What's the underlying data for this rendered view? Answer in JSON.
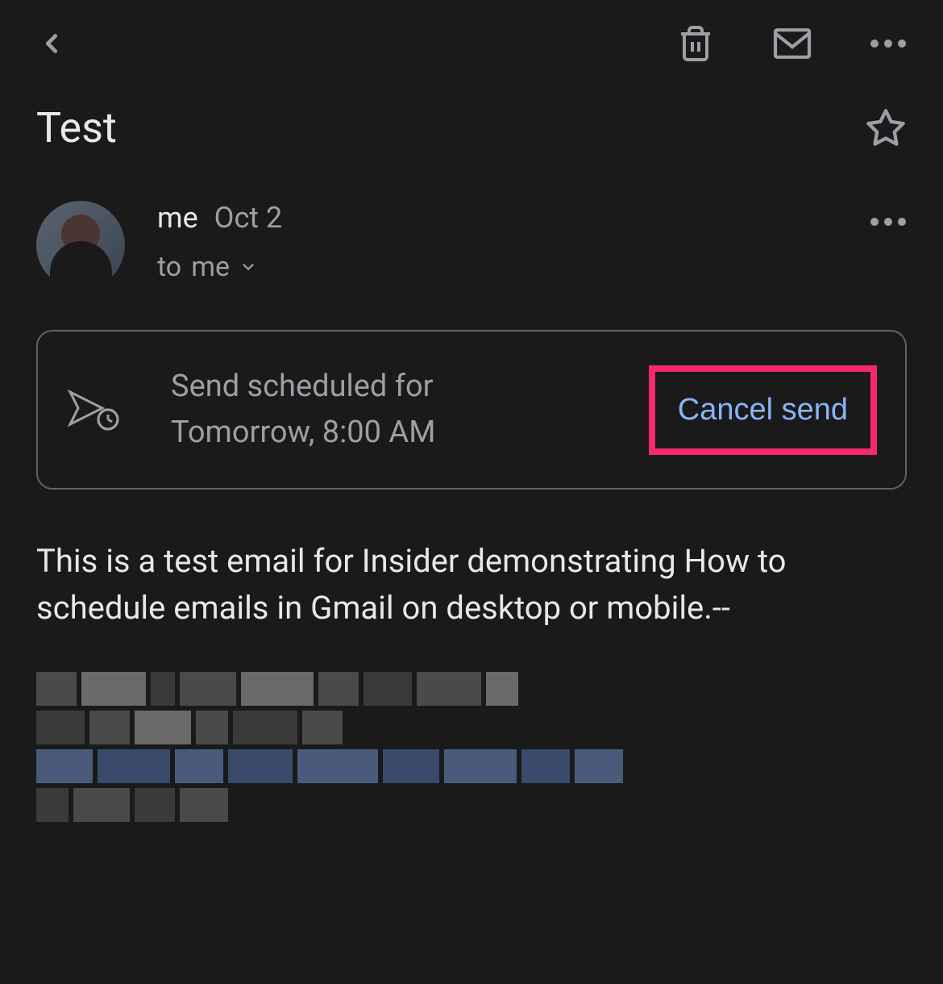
{
  "header": {
    "icons": {
      "back": "back-arrow",
      "delete": "trash",
      "mail": "envelope",
      "more": "dots"
    }
  },
  "subject": "Test",
  "sender": {
    "name": "me",
    "date": "Oct 2",
    "recipient_prefix": "to ",
    "recipient": "me"
  },
  "schedule": {
    "line1": "Send scheduled for",
    "line2": "Tomorrow, 8:00 AM",
    "cancel_label": "Cancel send"
  },
  "body": "This is a test email for Insider demonstrating How to schedule emails in Gmail on desktop or mobile.--",
  "colors": {
    "background": "#1a1a1a",
    "text_primary": "#e8e8e8",
    "text_secondary": "#9aa0a6",
    "accent_blue": "#8ab4f8",
    "highlight_pink": "#f7296e",
    "border": "#5f6368"
  }
}
